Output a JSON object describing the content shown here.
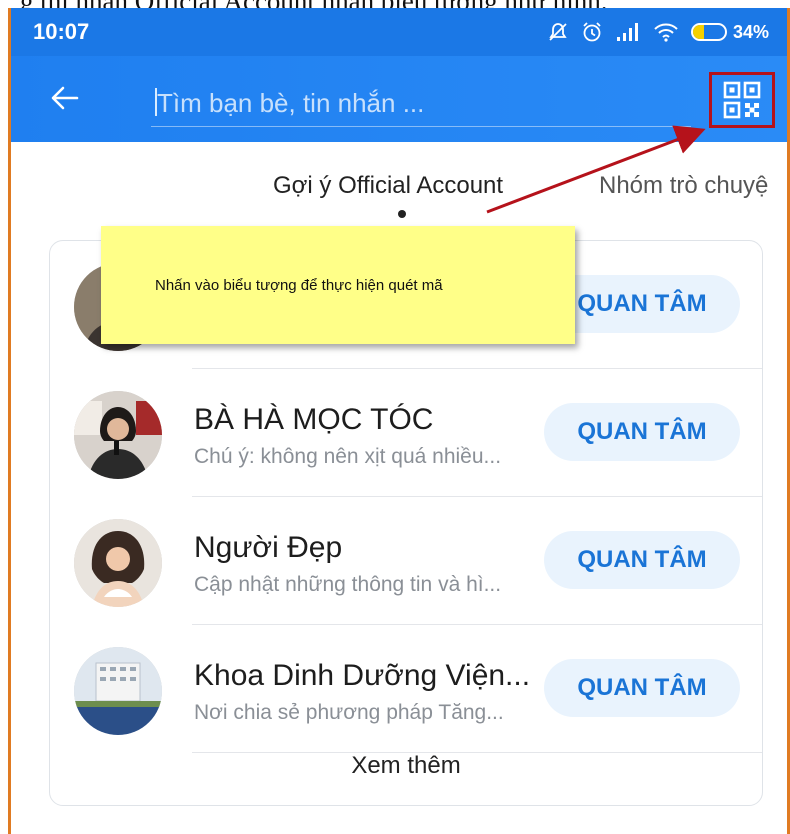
{
  "caption": "g thì nhấn Official Account nhấn biểu tượng như hình.",
  "status_bar": {
    "time": "10:07",
    "battery_percent": "34%",
    "battery_level": 0.34,
    "icons": [
      "mute-icon",
      "alarm-icon",
      "signal-icon",
      "wifi-icon",
      "battery-icon"
    ]
  },
  "app_bar": {
    "back_icon": "back-arrow-icon",
    "search_placeholder": "Tìm bạn bè, tin nhắn ...",
    "search_value": "",
    "qr_icon": "qr-code-icon"
  },
  "tabs": [
    {
      "label": "Gợi ý Official Account",
      "active": true
    },
    {
      "label": "Nhóm trò chuyệ",
      "active": false
    }
  ],
  "accounts": [
    {
      "name": "",
      "description": "",
      "button": "QUAN TÂM"
    },
    {
      "name": "BÀ HÀ MỌC TÓC",
      "description": "Chú ý: không nên xịt quá nhiều...",
      "button": "QUAN TÂM"
    },
    {
      "name": "Người Đẹp",
      "description": "Cập nhật những thông tin và hì...",
      "button": "QUAN TÂM"
    },
    {
      "name": "Khoa Dinh Dưỡng Viện...",
      "description": "Nơi chia sẻ phương pháp Tăng...",
      "button": "QUAN TÂM"
    }
  ],
  "see_more": "Xem thêm",
  "annotation": {
    "callout_text": "Nhấn vào biểu tượng để thực hiện quét mã",
    "callout_color": "#ffff88",
    "arrow_color": "#b5121b"
  },
  "colors": {
    "app_bar": "#1f7ff0",
    "accent_text": "#1a74d6",
    "button_bg": "#e9f3fd",
    "frame": "#e07b22"
  }
}
